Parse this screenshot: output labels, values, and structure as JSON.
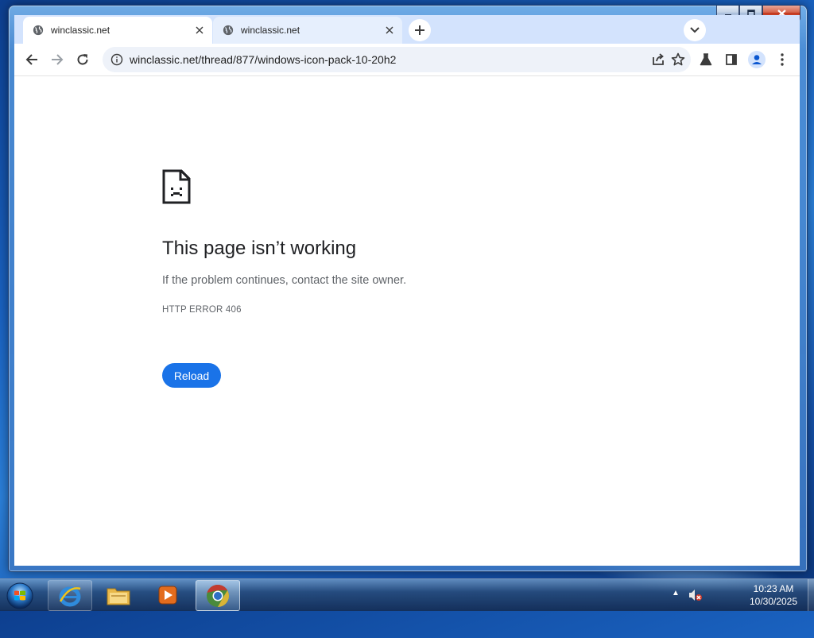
{
  "browser": {
    "tabs": [
      {
        "title": "winclassic.net",
        "active": true
      },
      {
        "title": "winclassic.net",
        "active": false
      }
    ],
    "new_tab_glyph": "+",
    "close_glyph": "✕",
    "omnibox": {
      "url": "winclassic.net/thread/877/windows-icon-pack-10-20h2"
    },
    "toolbar_icons": [
      "back-icon",
      "forward-icon",
      "reload-icon",
      "info-icon",
      "share-icon",
      "star-icon",
      "labs-icon",
      "side-panel-icon",
      "profile-icon",
      "menu-icon"
    ]
  },
  "error_page": {
    "heading": "This page isn’t working",
    "message": "If the problem continues, contact the site owner.",
    "code": "HTTP ERROR 406",
    "reload_label": "Reload"
  },
  "window": {
    "caption_buttons": [
      "minimize",
      "maximize",
      "close"
    ]
  },
  "taskbar": {
    "clock_time": "10:23 AM",
    "clock_date": "10/30/2025",
    "tray_arrow": "▲",
    "pinned": [
      "internet-explorer-icon",
      "file-explorer-icon",
      "media-player-icon",
      "chrome-icon"
    ]
  },
  "colors": {
    "accent": "#1a73e8",
    "tabstrip": "#d3e3fd",
    "omnibox": "#eef2f9"
  }
}
